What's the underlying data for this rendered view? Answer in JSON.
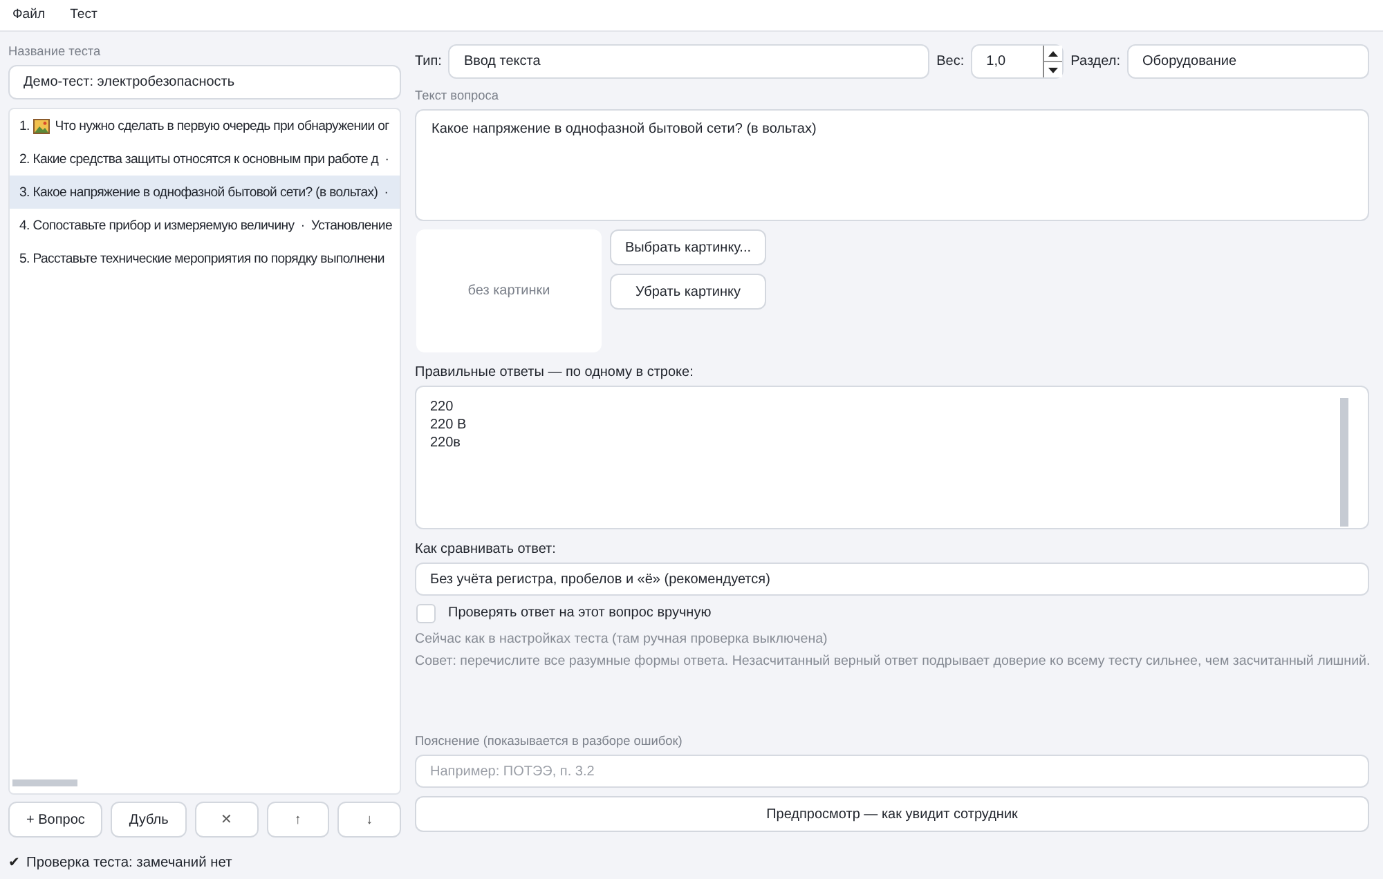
{
  "menu": [
    {
      "label": "Файл"
    },
    {
      "label": "Тест"
    }
  ],
  "test_name": {
    "label": "Название теста",
    "value": "Демо-тест: электробезопасность"
  },
  "questions": [
    {
      "number": "1.",
      "picture": true,
      "text": "Что нужно сделать в первую очередь при обнаружении ог",
      "selected": false
    },
    {
      "number": "2.",
      "picture": false,
      "text": "Какие средства защиты относятся к основным при работе д  ·",
      "selected": false
    },
    {
      "number": "3.",
      "picture": false,
      "text": "Какое напряжение в однофазной бытовой сети? (в вольтах)  ·",
      "selected": true
    },
    {
      "number": "4.",
      "picture": false,
      "text": "Сопоставьте прибор и измеряемую величину  ·  Установление",
      "selected": false
    },
    {
      "number": "5.",
      "picture": false,
      "text": "Расставьте технические мероприятия по порядку выполнени",
      "selected": false
    }
  ],
  "list_buttons": [
    "+ Вопрос",
    "Дубль",
    "✕",
    "↑",
    "↓"
  ],
  "status": {
    "icon": "✔",
    "text": "Проверка теста: замечаний нет"
  },
  "editor": {
    "type": {
      "label": "Тип:",
      "value": "Ввод текста"
    },
    "weight": {
      "label": "Вес:",
      "value": "1,0"
    },
    "section": {
      "label": "Раздел:",
      "value": "Оборудование"
    },
    "question_text": {
      "label": "Текст вопроса",
      "value": "Какое напряжение в однофазной бытовой сети? (в вольтах)"
    },
    "image": {
      "empty_text": "без картинки",
      "buttons": [
        "Выбрать картинку...",
        "Убрать картинку"
      ]
    },
    "answers": {
      "label": "Правильные ответы — по одному в строке:",
      "lines": [
        "220",
        "220 В",
        "220в"
      ]
    },
    "compare": {
      "label": "Как сравнивать ответ:",
      "value": "Без учёта регистра, пробелов и «ё» (рекомендуется)"
    },
    "manual_check": {
      "label": "Проверять ответ на этот вопрос вручную",
      "checked": false
    },
    "notes": [
      "Сейчас как в настройках теста (там ручная проверка выключена)",
      "Совет: перечислите все разумные формы ответа. Незасчитанный верный ответ подрывает доверие ко всему тесту сильнее, чем засчитанный лишний."
    ],
    "explanation": {
      "label": "Пояснение (показывается в разборе ошибок)",
      "placeholder": "Например: ПОТЭЭ, п. 3.2"
    },
    "preview_button": "Предпросмотр — как увидит сотрудник"
  }
}
